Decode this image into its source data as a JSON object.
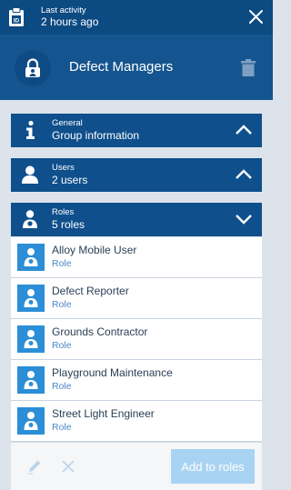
{
  "topbar": {
    "activity_label": "Last activity",
    "activity_value": "2 hours ago",
    "icons": {
      "left": "clipboard-id-icon",
      "right": "close-icon"
    }
  },
  "group": {
    "title": "Defect Managers",
    "icons": {
      "avatar": "lock-group-icon",
      "delete": "trash-icon"
    }
  },
  "sections": {
    "general": {
      "label": "General",
      "value": "Group information",
      "icon": "info-icon",
      "state": "collapsed"
    },
    "users": {
      "label": "Users",
      "value": "2 users",
      "icon": "user-icon",
      "state": "collapsed"
    },
    "roles": {
      "label": "Roles",
      "value": "5 roles",
      "icon": "role-icon",
      "state": "expanded"
    }
  },
  "roles": [
    {
      "name": "Alloy Mobile User",
      "type": "Role"
    },
    {
      "name": "Defect Reporter",
      "type": "Role"
    },
    {
      "name": "Grounds Contractor",
      "type": "Role"
    },
    {
      "name": "Playground Maintenance",
      "type": "Role"
    },
    {
      "name": "Street Light Engineer",
      "type": "Role"
    }
  ],
  "footer": {
    "add_label": "Add to roles",
    "icons": {
      "edit": "pencil-icon",
      "clear": "close-icon"
    }
  },
  "colors": {
    "topbar": "#0c4a82",
    "header": "#15558f",
    "section": "#0f4f8c",
    "role_icon": "#2b8ed6",
    "role_sub": "#4a88c7",
    "button_disabled": "#a9d3f2"
  }
}
